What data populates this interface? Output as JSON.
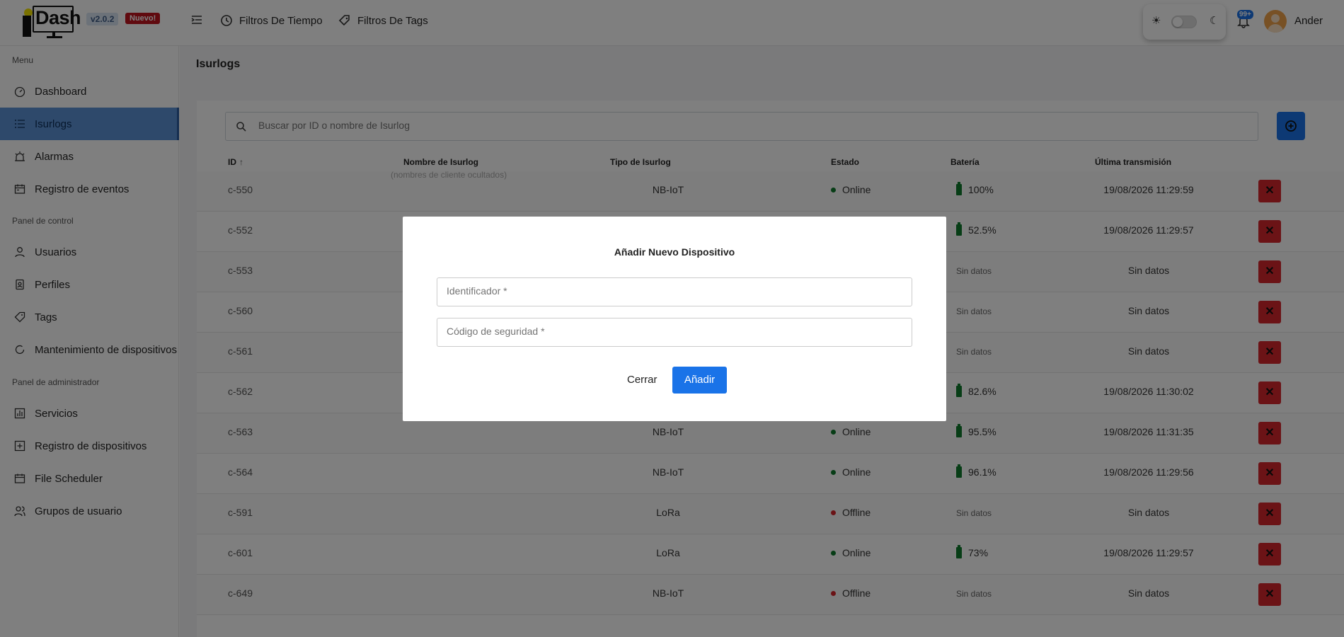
{
  "header": {
    "logo_text": "Dash",
    "version": "v2.0.2",
    "new_badge": "Nuevo!",
    "time_filters_label": "Filtros De Tiempo",
    "tag_filters_label": "Filtros De Tags",
    "notifications_count": "99+",
    "username": "Ander"
  },
  "sidebar": {
    "sections": [
      {
        "title": "Menu"
      },
      {
        "title": "Panel de control"
      },
      {
        "title": "Panel de administrador"
      }
    ],
    "items": [
      {
        "label": "Dashboard",
        "icon": "dashboard-icon"
      },
      {
        "label": "Isurlogs",
        "icon": "list-icon",
        "active": true
      },
      {
        "label": "Alarmas",
        "icon": "alarm-icon"
      },
      {
        "label": "Registro de eventos",
        "icon": "calendar-icon"
      },
      {
        "label": "Usuarios",
        "icon": "user-icon"
      },
      {
        "label": "Perfiles",
        "icon": "profile-icon"
      },
      {
        "label": "Tags",
        "icon": "tag-icon"
      },
      {
        "label": "Mantenimiento de dispositivos",
        "icon": "refresh-icon"
      },
      {
        "label": "Servicios",
        "icon": "services-icon"
      },
      {
        "label": "Registro de dispositivos",
        "icon": "plus-square-icon"
      },
      {
        "label": "File Scheduler",
        "icon": "calendar-icon"
      },
      {
        "label": "Grupos de usuario",
        "icon": "users-icon"
      }
    ]
  },
  "main": {
    "page_title": "Isurlogs",
    "search_placeholder": "Buscar por ID o nombre de Isurlog",
    "hidden_names_note": "(nombres de cliente ocultados)",
    "columns": [
      "ID",
      "Nombre de Isurlog",
      "Tipo de Isurlog",
      "Estado",
      "Batería",
      "Última transmisión"
    ],
    "rows": [
      {
        "id": "c-550",
        "type": "NB-IoT",
        "status": "Online",
        "battery": "100%",
        "last": "19/08/2026 11:29:59"
      },
      {
        "id": "c-552",
        "type": "",
        "status": "",
        "battery": "52.5%",
        "last": "19/08/2026 11:29:57"
      },
      {
        "id": "c-553",
        "type": "",
        "status": "",
        "battery": "Sin datos",
        "last": "Sin datos"
      },
      {
        "id": "c-560",
        "type": "",
        "status": "",
        "battery": "Sin datos",
        "last": "Sin datos"
      },
      {
        "id": "c-561",
        "type": "",
        "status": "",
        "battery": "Sin datos",
        "last": "Sin datos"
      },
      {
        "id": "c-562",
        "type": "",
        "status": "",
        "battery": "82.6%",
        "last": "19/08/2026 11:30:02"
      },
      {
        "id": "c-563",
        "type": "NB-IoT",
        "status": "Online",
        "battery": "95.5%",
        "last": "19/08/2026 11:31:35"
      },
      {
        "id": "c-564",
        "type": "NB-IoT",
        "status": "Online",
        "battery": "96.1%",
        "last": "19/08/2026 11:29:56"
      },
      {
        "id": "c-591",
        "type": "LoRa",
        "status": "Offline",
        "battery": "Sin datos",
        "last": "Sin datos"
      },
      {
        "id": "c-601",
        "type": "LoRa",
        "status": "Online",
        "battery": "73%",
        "last": "19/08/2026 11:29:57"
      },
      {
        "id": "c-649",
        "type": "NB-IoT",
        "status": "Offline",
        "battery": "Sin datos",
        "last": "Sin datos"
      }
    ]
  },
  "modal": {
    "title": "Añadir Nuevo Dispositivo",
    "identifier_placeholder": "Identificador *",
    "security_code_placeholder": "Código de seguridad *",
    "close_label": "Cerrar",
    "add_label": "Añadir"
  },
  "colors": {
    "accent": "#1a73e8",
    "online": "#0e7a2c",
    "offline": "#d6272d",
    "active_nav": "#5c93d6"
  }
}
